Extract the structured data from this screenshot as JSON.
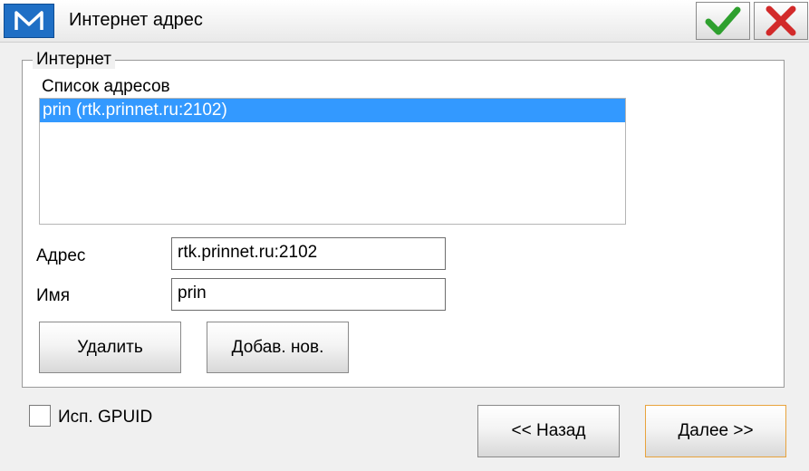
{
  "window": {
    "title": "Интернет адрес"
  },
  "icons": {
    "app": "m-logo-icon",
    "ok": "checkmark-icon",
    "cancel": "close-icon"
  },
  "colors": {
    "accent": "#1f6fc5",
    "selection": "#3399ff",
    "ok": "#2ea02e",
    "cancel": "#d22a2a",
    "focus_border": "#e8a33d"
  },
  "group": {
    "legend": "Интернет",
    "list_caption": "Список адресов",
    "addresses": [
      "prin (rtk.prinnet.ru:2102)"
    ],
    "selected_index": 0
  },
  "form": {
    "address_label": "Адрес",
    "address_value": "rtk.prinnet.ru:2102",
    "name_label": "Имя",
    "name_value": "prin",
    "delete_button": "Удалить",
    "add_button": "Добав. нов."
  },
  "options": {
    "gpuid_label": "Исп. GPUID",
    "gpuid_checked": false
  },
  "navigation": {
    "back_button": "<< Назад",
    "next_button": "Далее >>"
  }
}
